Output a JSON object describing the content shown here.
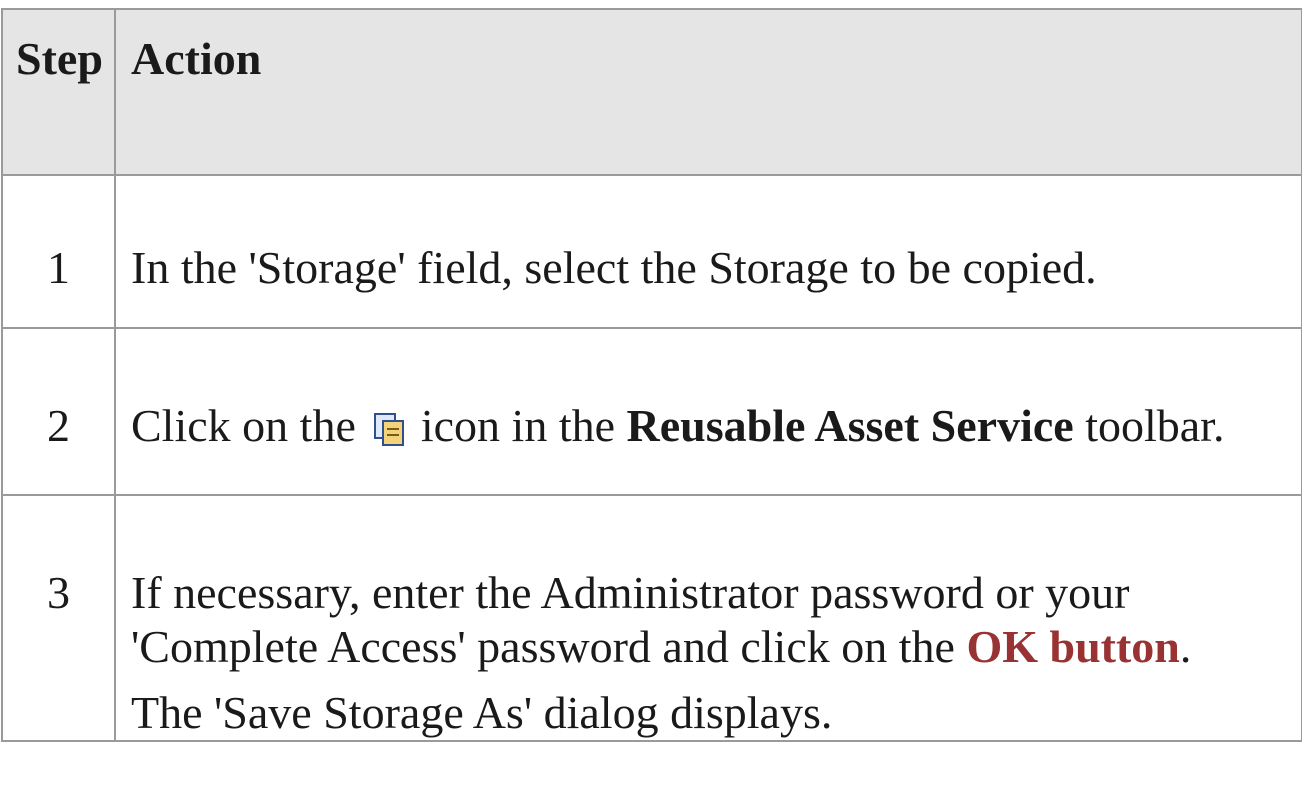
{
  "table": {
    "headers": {
      "step": "Step",
      "action": "Action"
    },
    "rows": [
      {
        "step": "1",
        "action": "In the 'Storage' field, select the Storage to be copied."
      },
      {
        "step": "2",
        "action_prefix": "Click on the",
        "icon": "copy-storage-icon",
        "action_middle": " icon in the ",
        "action_bold": "Reusable Asset Service",
        "action_suffix": " toolbar."
      },
      {
        "step": "3",
        "action_prefix": "If necessary, enter the Administrator password or your 'Complete Access' password and click on the ",
        "action_link": "OK button",
        "action_suffix": ".",
        "action_note": "The 'Save Storage As' dialog displays."
      }
    ]
  },
  "colors": {
    "header_background": "#e5e5e5",
    "border": "#9a9a9a",
    "link_text": "#993333"
  }
}
